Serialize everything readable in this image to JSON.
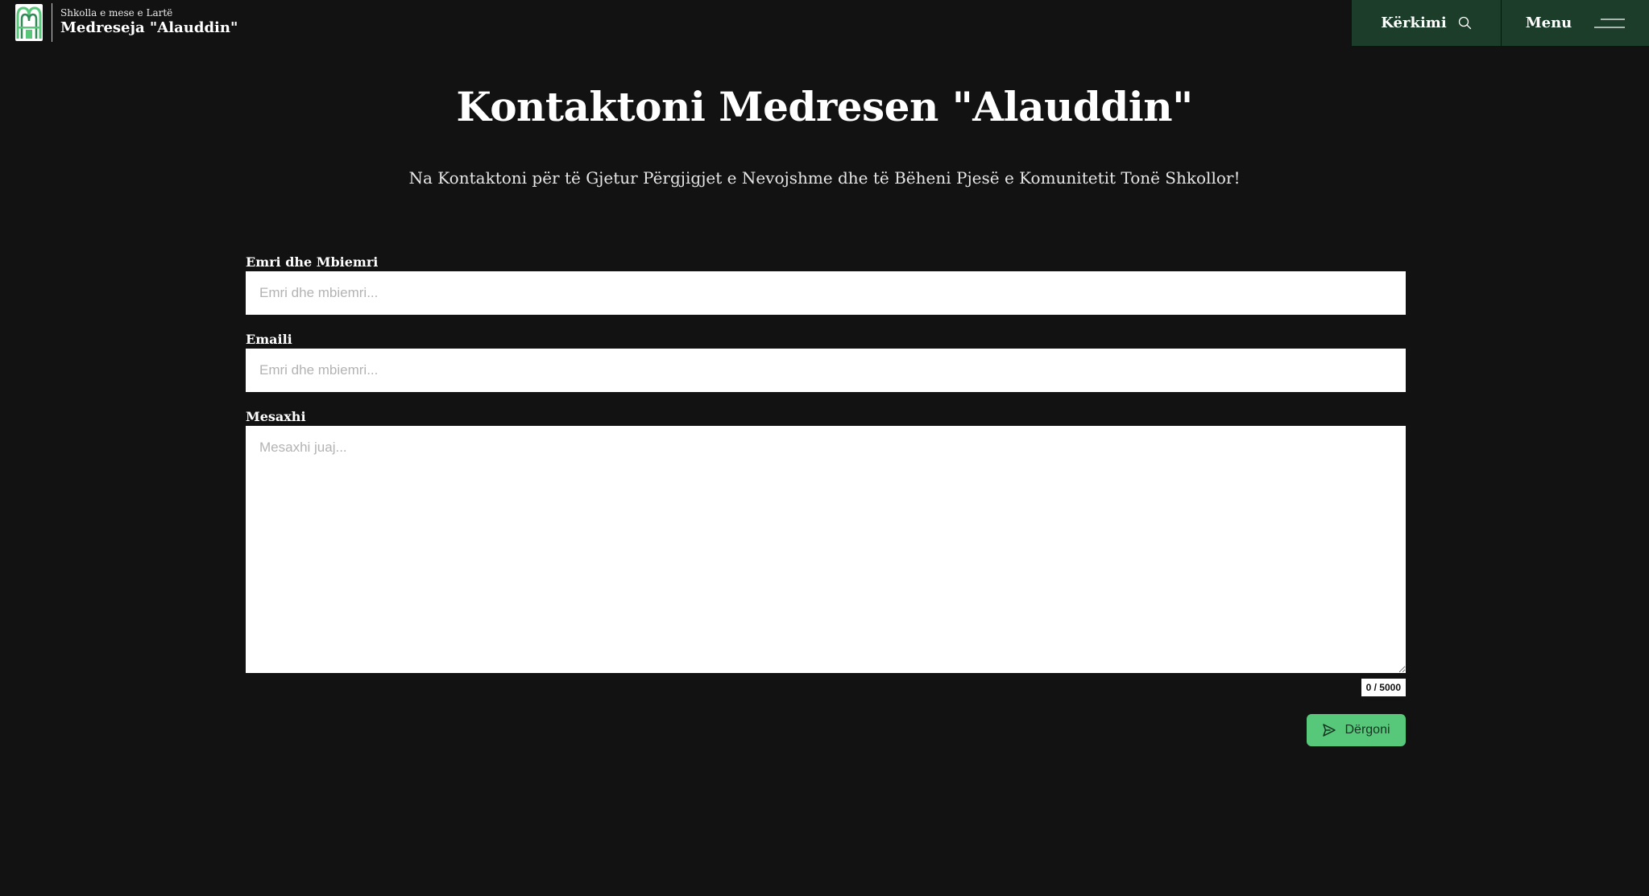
{
  "brand": {
    "subtitle": "Shkolla e mese e Lartë",
    "title": "Medreseja \"Alauddin\"",
    "logo_icon": "medrese-logo-icon",
    "accent_color": "#57c87a"
  },
  "nav": {
    "search_label": "Kërkimi",
    "search_icon": "search-icon",
    "menu_label": "Menu",
    "menu_icon": "hamburger-menu-icon",
    "background_color": "#1c3d2a"
  },
  "hero": {
    "title": "Kontaktoni Medresen \"Alauddin\"",
    "subtitle": "Na Kontaktoni për të Gjetur Përgjigjet e Nevojshme dhe të Bëheni Pjesë e Komunitetit Tonë Shkollor!"
  },
  "form": {
    "name": {
      "label": "Emri dhe Mbiemri",
      "placeholder": "Emri dhe mbiemri...",
      "value": ""
    },
    "email": {
      "label": "Emaili",
      "placeholder": "Emri dhe mbiemri...",
      "value": ""
    },
    "message": {
      "label": "Mesaxhi",
      "placeholder": "Mesaxhi juaj...",
      "value": ""
    },
    "counter": "0 / 5000",
    "submit_label": "Dërgoni",
    "submit_icon": "send-icon",
    "submit_color": "#57c87a"
  }
}
